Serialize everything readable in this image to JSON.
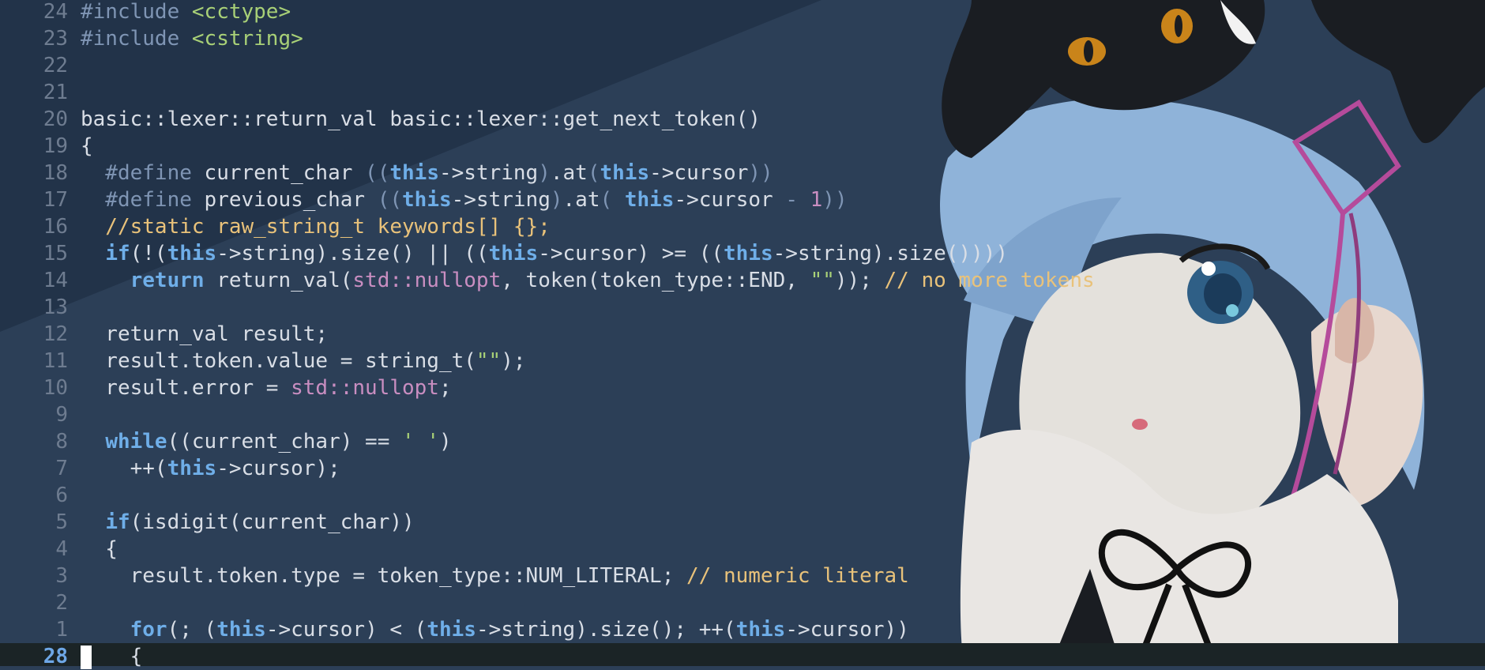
{
  "editor": {
    "lines": [
      {
        "num": "24",
        "tokens": [
          {
            "t": "#include ",
            "c": "pp"
          },
          {
            "t": "<cctype>",
            "c": "inc"
          }
        ]
      },
      {
        "num": "23",
        "tokens": [
          {
            "t": "#include ",
            "c": "pp"
          },
          {
            "t": "<cstring>",
            "c": "inc"
          }
        ]
      },
      {
        "num": "22",
        "tokens": []
      },
      {
        "num": "21",
        "tokens": []
      },
      {
        "num": "20",
        "tokens": [
          {
            "t": "basic::lexer::return_val basic::lexer::get_next_token()",
            "c": ""
          }
        ]
      },
      {
        "num": "19",
        "tokens": [
          {
            "t": "{",
            "c": ""
          }
        ]
      },
      {
        "num": "18",
        "tokens": [
          {
            "t": "  #define ",
            "c": "pp"
          },
          {
            "t": "current_char ",
            "c": ""
          },
          {
            "t": "((",
            "c": "dim"
          },
          {
            "t": "this",
            "c": "kw"
          },
          {
            "t": "->string",
            "c": ""
          },
          {
            "t": ")",
            "c": "dim"
          },
          {
            "t": ".at",
            "c": ""
          },
          {
            "t": "(",
            "c": "dim"
          },
          {
            "t": "this",
            "c": "kw"
          },
          {
            "t": "->cursor",
            "c": ""
          },
          {
            "t": "))",
            "c": "dim"
          }
        ]
      },
      {
        "num": "17",
        "tokens": [
          {
            "t": "  #define ",
            "c": "pp"
          },
          {
            "t": "previous_char ",
            "c": ""
          },
          {
            "t": "((",
            "c": "dim"
          },
          {
            "t": "this",
            "c": "kw"
          },
          {
            "t": "->string",
            "c": ""
          },
          {
            "t": ")",
            "c": "dim"
          },
          {
            "t": ".at",
            "c": ""
          },
          {
            "t": "( ",
            "c": "dim"
          },
          {
            "t": "this",
            "c": "kw"
          },
          {
            "t": "->cursor ",
            "c": ""
          },
          {
            "t": "- ",
            "c": "dim"
          },
          {
            "t": "1",
            "c": "num"
          },
          {
            "t": "))",
            "c": "dim"
          }
        ]
      },
      {
        "num": "16",
        "tokens": [
          {
            "t": "  //static raw_string_t keywords[] {};",
            "c": "cmt"
          }
        ]
      },
      {
        "num": "15",
        "tokens": [
          {
            "t": "  ",
            "c": ""
          },
          {
            "t": "if",
            "c": "kw"
          },
          {
            "t": "(!(",
            "c": ""
          },
          {
            "t": "this",
            "c": "kw"
          },
          {
            "t": "->string).size() || ((",
            "c": ""
          },
          {
            "t": "this",
            "c": "kw"
          },
          {
            "t": "->cursor) >= ((",
            "c": ""
          },
          {
            "t": "this",
            "c": "kw"
          },
          {
            "t": "->string).size())))",
            "c": ""
          }
        ]
      },
      {
        "num": "14",
        "tokens": [
          {
            "t": "    ",
            "c": ""
          },
          {
            "t": "return",
            "c": "kw"
          },
          {
            "t": " return_val(",
            "c": ""
          },
          {
            "t": "std::nullopt",
            "c": "ns"
          },
          {
            "t": ", token(token_type::END, ",
            "c": ""
          },
          {
            "t": "\"\"",
            "c": "str"
          },
          {
            "t": ")); ",
            "c": ""
          },
          {
            "t": "// no more tokens",
            "c": "cmt"
          }
        ]
      },
      {
        "num": "13",
        "tokens": []
      },
      {
        "num": "12",
        "tokens": [
          {
            "t": "  return_val result;",
            "c": ""
          }
        ]
      },
      {
        "num": "11",
        "tokens": [
          {
            "t": "  result.token.value = string_t(",
            "c": ""
          },
          {
            "t": "\"\"",
            "c": "str"
          },
          {
            "t": ");",
            "c": ""
          }
        ]
      },
      {
        "num": "10",
        "tokens": [
          {
            "t": "  result.error = ",
            "c": ""
          },
          {
            "t": "std::nullopt",
            "c": "ns"
          },
          {
            "t": ";",
            "c": ""
          }
        ]
      },
      {
        "num": "9",
        "tokens": []
      },
      {
        "num": "8",
        "tokens": [
          {
            "t": "  ",
            "c": ""
          },
          {
            "t": "while",
            "c": "kw"
          },
          {
            "t": "((current_char) == ",
            "c": ""
          },
          {
            "t": "' '",
            "c": "str"
          },
          {
            "t": ")",
            "c": ""
          }
        ]
      },
      {
        "num": "7",
        "tokens": [
          {
            "t": "    ++(",
            "c": ""
          },
          {
            "t": "this",
            "c": "kw"
          },
          {
            "t": "->cursor);",
            "c": ""
          }
        ]
      },
      {
        "num": "6",
        "tokens": []
      },
      {
        "num": "5",
        "tokens": [
          {
            "t": "  ",
            "c": ""
          },
          {
            "t": "if",
            "c": "kw"
          },
          {
            "t": "(isdigit(current_char))",
            "c": ""
          }
        ]
      },
      {
        "num": "4",
        "tokens": [
          {
            "t": "  {",
            "c": ""
          }
        ]
      },
      {
        "num": "3",
        "tokens": [
          {
            "t": "    result.token.type = token_type::NUM_LITERAL; ",
            "c": ""
          },
          {
            "t": "// numeric literal",
            "c": "cmt"
          }
        ]
      },
      {
        "num": "2",
        "tokens": []
      },
      {
        "num": "1",
        "tokens": [
          {
            "t": "    ",
            "c": ""
          },
          {
            "t": "for",
            "c": "kw"
          },
          {
            "t": "(; (",
            "c": ""
          },
          {
            "t": "this",
            "c": "kw"
          },
          {
            "t": "->cursor) < (",
            "c": ""
          },
          {
            "t": "this",
            "c": "kw"
          },
          {
            "t": "->string).size(); ++(",
            "c": ""
          },
          {
            "t": "this",
            "c": "kw"
          },
          {
            "t": "->cursor))",
            "c": ""
          }
        ]
      }
    ],
    "current_line": {
      "num": "28",
      "tokens": [
        {
          "t": "    {",
          "c": ""
        }
      ]
    }
  },
  "wallpaper": {
    "description_icon": "anime-girl-wallpaper"
  }
}
